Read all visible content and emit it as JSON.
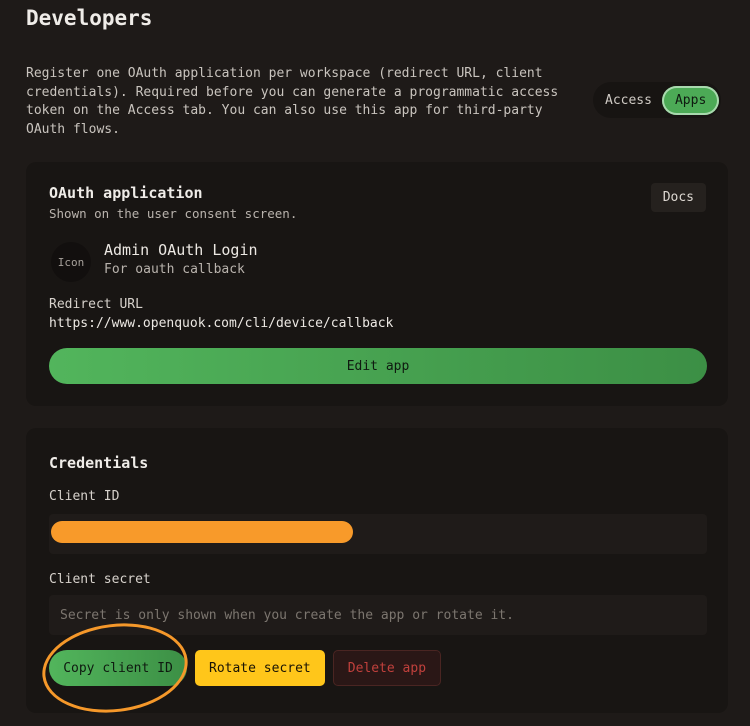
{
  "page": {
    "title": "Developers",
    "intro": "Register one OAuth application per workspace (redirect URL, client credentials). Required before you can generate a programmatic access token on the Access tab. You can also use this app for third-party OAuth flows."
  },
  "tabs": [
    {
      "label": "Access",
      "active": false
    },
    {
      "label": "Apps",
      "active": true
    }
  ],
  "oauth_card": {
    "title": "OAuth application",
    "subtitle": "Shown on the user consent screen.",
    "docs_label": "Docs",
    "app": {
      "icon_label": "Icon",
      "name": "Admin OAuth Login",
      "description": "For oauth callback"
    },
    "redirect_label": "Redirect URL",
    "redirect_url": "https://www.openquok.com/cli/device/callback",
    "edit_label": "Edit app"
  },
  "credentials_card": {
    "title": "Credentials",
    "client_id_label": "Client ID",
    "client_secret_label": "Client secret",
    "client_secret_placeholder": "Secret is only shown when you create the app or rotate it.",
    "copy_label": "Copy client ID",
    "rotate_label": "Rotate secret",
    "delete_label": "Delete app"
  },
  "colors": {
    "accent_green": "#4caa56",
    "rotate_yellow": "#ffc61a",
    "delete_red": "#c0403c",
    "annotation_orange": "#f5982a"
  }
}
